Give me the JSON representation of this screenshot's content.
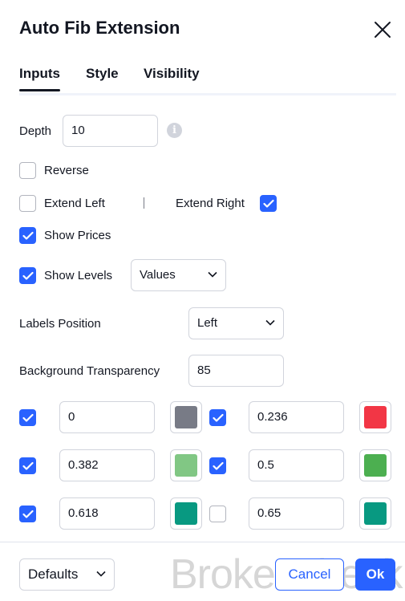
{
  "dialog": {
    "title": "Auto Fib Extension",
    "tabs": [
      "Inputs",
      "Style",
      "Visibility"
    ],
    "active_tab": "Inputs"
  },
  "inputs": {
    "depth_label": "Depth",
    "depth_value": "10",
    "reverse_label": "Reverse",
    "reverse_checked": false,
    "extend_left_label": "Extend Left",
    "extend_left_checked": false,
    "separator": "|",
    "extend_right_label": "Extend Right",
    "extend_right_checked": true,
    "show_prices_label": "Show Prices",
    "show_prices_checked": true,
    "show_levels_label": "Show Levels",
    "show_levels_checked": true,
    "show_levels_select": "Values",
    "labels_position_label": "Labels Position",
    "labels_position_select": "Left",
    "bg_transparency_label": "Background Transparency",
    "bg_transparency_value": "85"
  },
  "levels": [
    {
      "value": "0",
      "checked": true,
      "color": "#787b86"
    },
    {
      "value": "0.236",
      "checked": true,
      "color": "#f23645"
    },
    {
      "value": "0.382",
      "checked": true,
      "color": "#81c784"
    },
    {
      "value": "0.5",
      "checked": true,
      "color": "#4caf50"
    },
    {
      "value": "0.618",
      "checked": true,
      "color": "#089981"
    },
    {
      "value": "0.65",
      "checked": false,
      "color": "#089981"
    }
  ],
  "footer": {
    "defaults_label": "Defaults",
    "cancel_label": "Cancel",
    "ok_label": "Ok"
  },
  "watermark": "BrokerCheck",
  "colors": {
    "accent": "#2962ff",
    "text": "#131722",
    "border": "#d1d4dc"
  }
}
